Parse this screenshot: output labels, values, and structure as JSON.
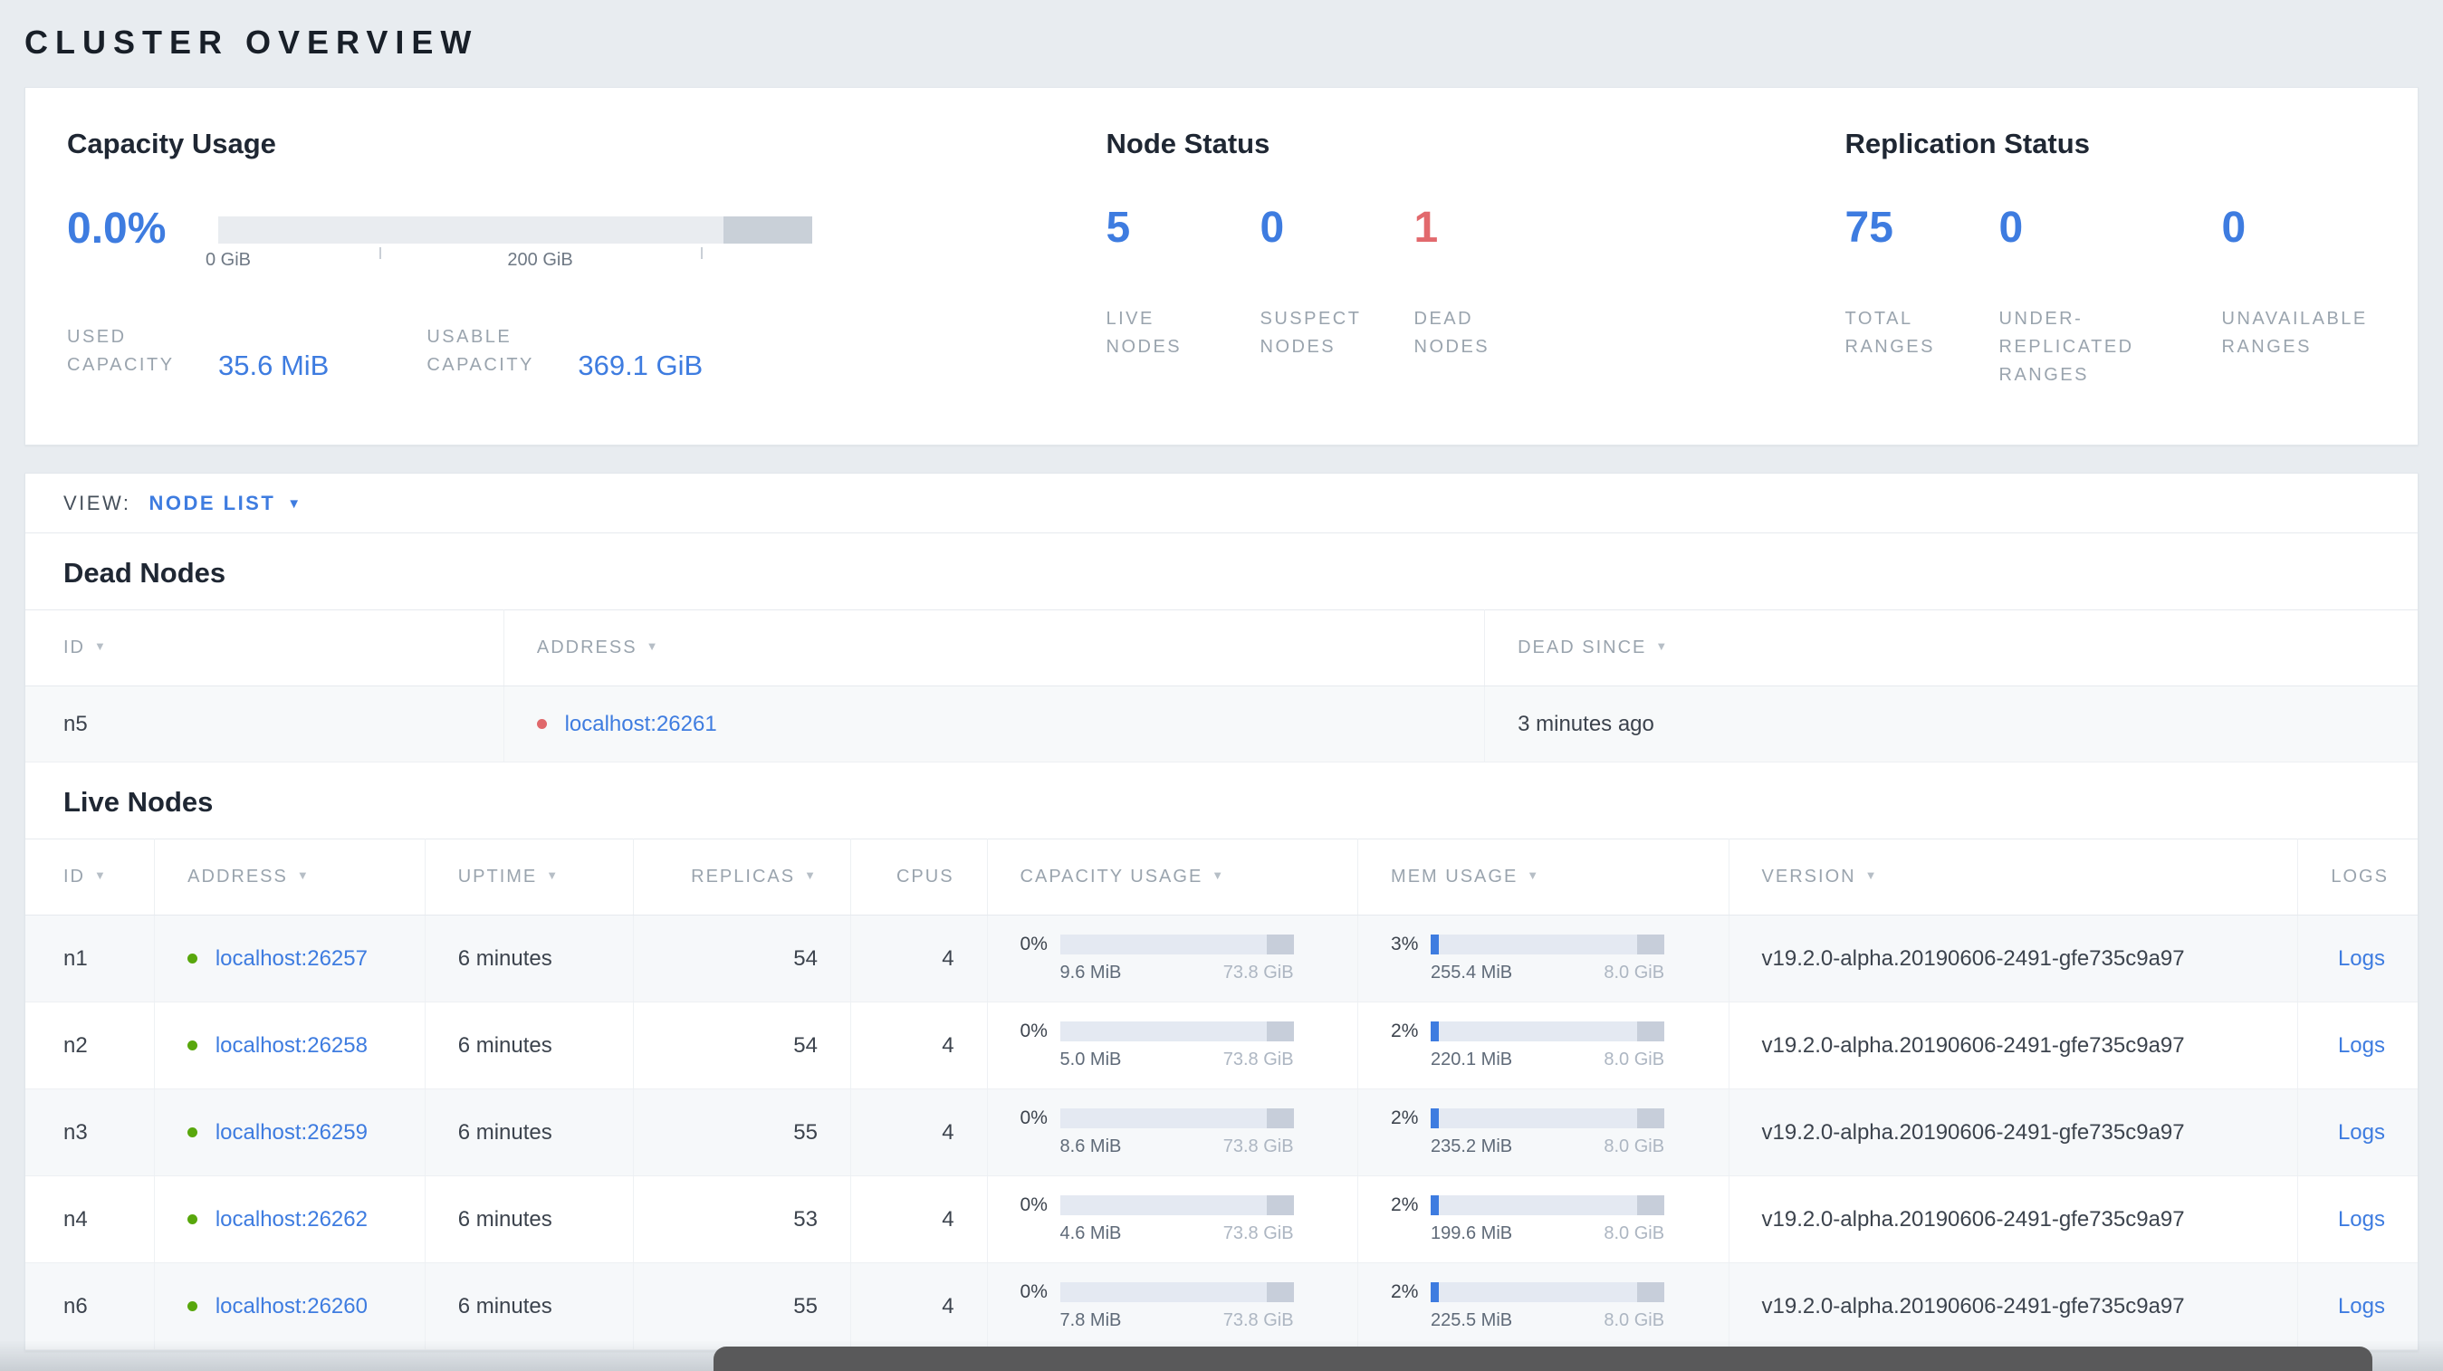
{
  "page": {
    "title": "CLUSTER OVERVIEW"
  },
  "icons": {
    "sort": "▼",
    "caret": "▼"
  },
  "colors": {
    "accent_blue": "#3e7ce0",
    "alert_red": "#e2696d",
    "live_green": "#58a70c"
  },
  "summary": {
    "capacity": {
      "title": "Capacity Usage",
      "percent": "0.0%",
      "tick_labels": [
        "0 GiB",
        "200 GiB"
      ],
      "used_label": "USED CAPACITY",
      "used_value": "35.6 MiB",
      "usable_label": "USABLE CAPACITY",
      "usable_value": "369.1 GiB"
    },
    "node_status": {
      "title": "Node Status",
      "metrics": [
        {
          "value": "5",
          "label": "LIVE NODES"
        },
        {
          "value": "0",
          "label": "SUSPECT NODES"
        },
        {
          "value": "1",
          "label": "DEAD NODES"
        }
      ]
    },
    "replication": {
      "title": "Replication Status",
      "metrics": [
        {
          "value": "75",
          "label": "TOTAL RANGES"
        },
        {
          "value": "0",
          "label": "UNDER-REPLICATED RANGES"
        },
        {
          "value": "0",
          "label": "UNAVAILABLE RANGES"
        }
      ]
    }
  },
  "view_bar": {
    "label": "VIEW:",
    "selected": "NODE LIST"
  },
  "dead_nodes": {
    "title": "Dead Nodes",
    "columns": [
      "ID",
      "ADDRESS",
      "DEAD SINCE"
    ],
    "rows": [
      {
        "id": "n5",
        "address": "localhost:26261",
        "dead_since": "3 minutes ago"
      }
    ]
  },
  "live_nodes": {
    "title": "Live Nodes",
    "columns": [
      "ID",
      "ADDRESS",
      "UPTIME",
      "REPLICAS",
      "CPUS",
      "CAPACITY USAGE",
      "MEM USAGE",
      "VERSION",
      "LOGS"
    ],
    "rows": [
      {
        "id": "n1",
        "address": "localhost:26257",
        "uptime": "6 minutes",
        "replicas": "54",
        "cpus": "4",
        "cap_pct": "0%",
        "cap_used": "9.6 MiB",
        "cap_total": "73.8 GiB",
        "mem_pct": "3%",
        "mem_used": "255.4 MiB",
        "mem_total": "8.0 GiB",
        "version": "v19.2.0-alpha.20190606-2491-gfe735c9a97",
        "logs_label": "Logs"
      },
      {
        "id": "n2",
        "address": "localhost:26258",
        "uptime": "6 minutes",
        "replicas": "54",
        "cpus": "4",
        "cap_pct": "0%",
        "cap_used": "5.0 MiB",
        "cap_total": "73.8 GiB",
        "mem_pct": "2%",
        "mem_used": "220.1 MiB",
        "mem_total": "8.0 GiB",
        "version": "v19.2.0-alpha.20190606-2491-gfe735c9a97",
        "logs_label": "Logs"
      },
      {
        "id": "n3",
        "address": "localhost:26259",
        "uptime": "6 minutes",
        "replicas": "55",
        "cpus": "4",
        "cap_pct": "0%",
        "cap_used": "8.6 MiB",
        "cap_total": "73.8 GiB",
        "mem_pct": "2%",
        "mem_used": "235.2 MiB",
        "mem_total": "8.0 GiB",
        "version": "v19.2.0-alpha.20190606-2491-gfe735c9a97",
        "logs_label": "Logs"
      },
      {
        "id": "n4",
        "address": "localhost:26262",
        "uptime": "6 minutes",
        "replicas": "53",
        "cpus": "4",
        "cap_pct": "0%",
        "cap_used": "4.6 MiB",
        "cap_total": "73.8 GiB",
        "mem_pct": "2%",
        "mem_used": "199.6 MiB",
        "mem_total": "8.0 GiB",
        "version": "v19.2.0-alpha.20190606-2491-gfe735c9a97",
        "logs_label": "Logs"
      },
      {
        "id": "n6",
        "address": "localhost:26260",
        "uptime": "6 minutes",
        "replicas": "55",
        "cpus": "4",
        "cap_pct": "0%",
        "cap_used": "7.8 MiB",
        "cap_total": "73.8 GiB",
        "mem_pct": "2%",
        "mem_used": "225.5 MiB",
        "mem_total": "8.0 GiB",
        "version": "v19.2.0-alpha.20190606-2491-gfe735c9a97",
        "logs_label": "Logs"
      }
    ]
  }
}
